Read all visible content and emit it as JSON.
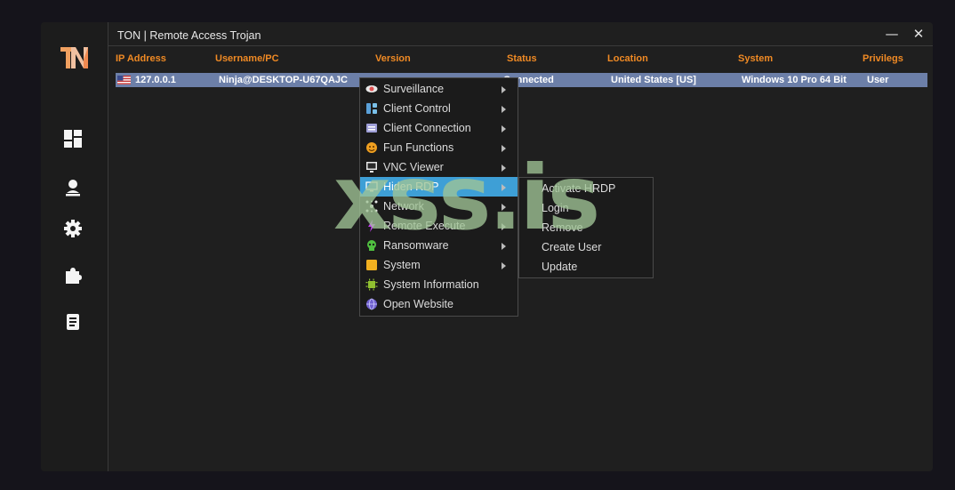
{
  "window": {
    "title": "TON | Remote Access Trojan",
    "minimize": "—",
    "close": "✕"
  },
  "sidebar": {
    "logo_text": "N",
    "items": [
      {
        "icon": "dashboard-icon"
      },
      {
        "icon": "user-icon"
      },
      {
        "icon": "settings-icon"
      },
      {
        "icon": "plugin-icon"
      },
      {
        "icon": "notes-icon"
      }
    ]
  },
  "table": {
    "headers": [
      "IP Address",
      "Username/PC",
      "Version",
      "Status",
      "Location",
      "System",
      "Privilegs"
    ],
    "rows": [
      {
        "ip": "127.0.0.1",
        "user": "Ninja@DESKTOP-U67QAJC",
        "status": "Connected",
        "location": "United States [US]",
        "system": "Windows 10 Pro 64 Bit",
        "privileges": "User"
      }
    ]
  },
  "context_menu": {
    "items": [
      {
        "label": "Surveillance",
        "icon": "eye-icon"
      },
      {
        "label": "Client Control",
        "icon": "control-icon"
      },
      {
        "label": "Client Connection",
        "icon": "connection-icon"
      },
      {
        "label": "Fun Functions",
        "icon": "fun-icon"
      },
      {
        "label": "VNC Viewer",
        "icon": "monitor-icon"
      },
      {
        "label": "Hiden RDP",
        "icon": "rdp-icon"
      },
      {
        "label": "Network",
        "icon": "network-icon"
      },
      {
        "label": "Remote Execute",
        "icon": "lightning-icon"
      },
      {
        "label": "Ransomware",
        "icon": "skull-icon"
      },
      {
        "label": "System",
        "icon": "system-icon"
      },
      {
        "label": "System Information",
        "icon": "chip-icon"
      },
      {
        "label": "Open Website",
        "icon": "globe-icon"
      }
    ]
  },
  "submenu": {
    "items": [
      {
        "label": "Activate HRDP"
      },
      {
        "label": "Login"
      },
      {
        "label": "Remove"
      },
      {
        "label": "Create User"
      },
      {
        "label": "Update"
      }
    ]
  },
  "watermark": "xss.is",
  "colors": {
    "header": "#f08a24",
    "selection": "#6c7fa8",
    "highlight": "#3e9fd6"
  }
}
